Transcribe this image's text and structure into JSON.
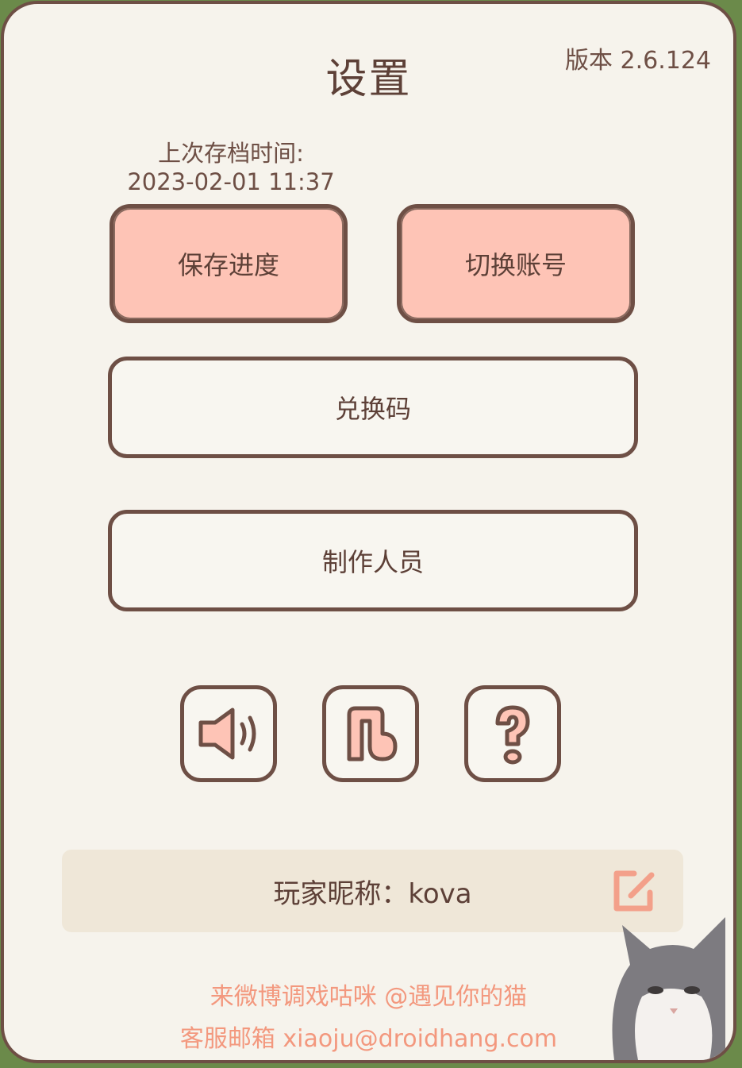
{
  "title": "设置",
  "version": "版本 2.6.124",
  "save_info": {
    "label": "上次存档时间:",
    "time": "2023-02-01 11:37"
  },
  "buttons": {
    "save_progress": "保存进度",
    "switch_account": "切换账号",
    "redeem_code": "兑换码",
    "credits": "制作人员"
  },
  "icons": [
    "speaker-icon",
    "music-note-icon",
    "question-mark-icon"
  ],
  "nickname": "玩家昵称：kova",
  "footer": {
    "weibo": "来微博调戏咕咪 @遇见你的猫",
    "email": "客服邮箱 xiaoju@droidhang.com"
  },
  "colors": {
    "border": "#6e4f45",
    "panel": "#f6f3ec",
    "accent_pink": "#fec4b6",
    "footer_text": "#f3987e"
  }
}
